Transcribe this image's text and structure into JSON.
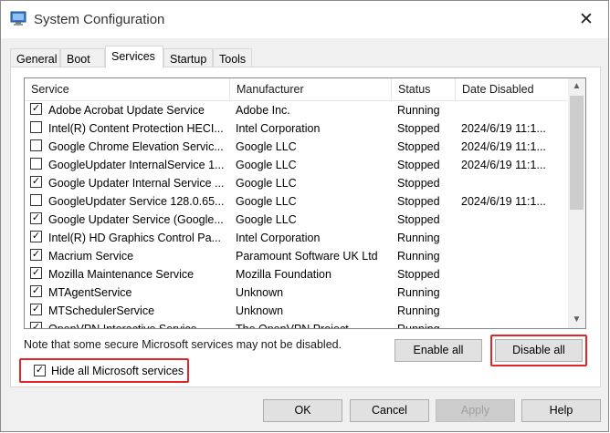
{
  "window": {
    "title": "System Configuration",
    "close_glyph": "✕",
    "app_icon": "msconfig-icon"
  },
  "tabs": [
    {
      "label": "General"
    },
    {
      "label": "Boot"
    },
    {
      "label": "Services",
      "active": true
    },
    {
      "label": "Startup"
    },
    {
      "label": "Tools"
    }
  ],
  "table": {
    "headers": [
      "Service",
      "Manufacturer",
      "Status",
      "Date Disabled"
    ],
    "rows": [
      {
        "checked": true,
        "service": "Adobe Acrobat Update Service",
        "manufacturer": "Adobe Inc.",
        "status": "Running",
        "date": ""
      },
      {
        "checked": false,
        "service": "Intel(R) Content Protection HECI...",
        "manufacturer": "Intel Corporation",
        "status": "Stopped",
        "date": "2024/6/19 11:1..."
      },
      {
        "checked": false,
        "service": "Google Chrome Elevation Servic...",
        "manufacturer": "Google LLC",
        "status": "Stopped",
        "date": "2024/6/19 11:1..."
      },
      {
        "checked": false,
        "service": "GoogleUpdater InternalService 1...",
        "manufacturer": "Google LLC",
        "status": "Stopped",
        "date": "2024/6/19 11:1..."
      },
      {
        "checked": true,
        "service": "Google Updater Internal Service ...",
        "manufacturer": "Google LLC",
        "status": "Stopped",
        "date": ""
      },
      {
        "checked": false,
        "service": "GoogleUpdater Service 128.0.65...",
        "manufacturer": "Google LLC",
        "status": "Stopped",
        "date": "2024/6/19 11:1..."
      },
      {
        "checked": true,
        "service": "Google Updater Service (Google...",
        "manufacturer": "Google LLC",
        "status": "Stopped",
        "date": ""
      },
      {
        "checked": true,
        "service": "Intel(R) HD Graphics Control Pa...",
        "manufacturer": "Intel Corporation",
        "status": "Running",
        "date": ""
      },
      {
        "checked": true,
        "service": "Macrium Service",
        "manufacturer": "Paramount Software UK Ltd",
        "status": "Running",
        "date": ""
      },
      {
        "checked": true,
        "service": "Mozilla Maintenance Service",
        "manufacturer": "Mozilla Foundation",
        "status": "Stopped",
        "date": ""
      },
      {
        "checked": true,
        "service": "MTAgentService",
        "manufacturer": "Unknown",
        "status": "Running",
        "date": ""
      },
      {
        "checked": true,
        "service": "MTSchedulerService",
        "manufacturer": "Unknown",
        "status": "Running",
        "date": ""
      },
      {
        "checked": true,
        "service": "OpenVPN Interactive Service",
        "manufacturer": "The OpenVPN Project",
        "status": "Running",
        "date": ""
      }
    ]
  },
  "note": "Note that some secure Microsoft services may not be disabled.",
  "buttons": {
    "enable_all": "Enable all",
    "disable_all": "Disable all",
    "ok": "OK",
    "cancel": "Cancel",
    "apply": "Apply",
    "help": "Help"
  },
  "hide_ms": {
    "label": "Hide all Microsoft services",
    "checked": true
  },
  "colors": {
    "highlight": "#e3262a"
  }
}
